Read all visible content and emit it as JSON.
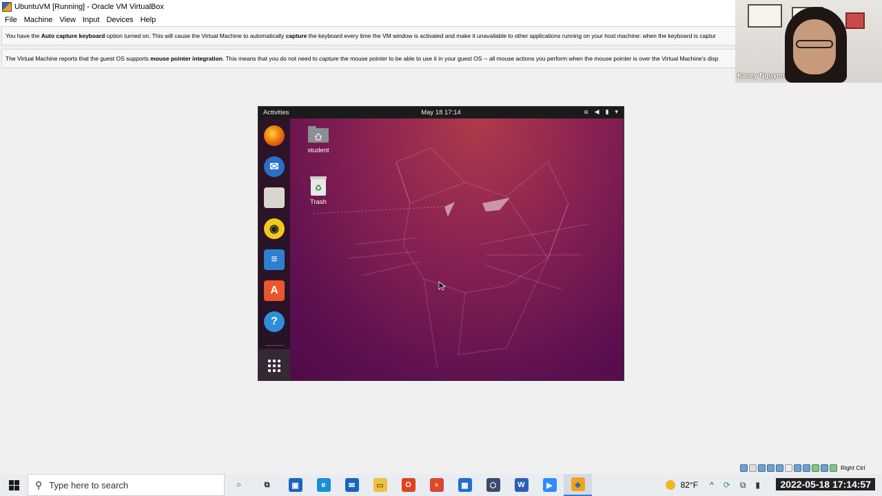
{
  "window": {
    "title": "UbuntuVM [Running] - Oracle VM VirtualBox"
  },
  "menu": [
    "File",
    "Machine",
    "View",
    "Input",
    "Devices",
    "Help"
  ],
  "banners": {
    "keyboard": {
      "p1": "You have the ",
      "b1": "Auto capture keyboard",
      "p2": " option turned on. This will cause the Virtual Machine to automatically ",
      "b2": "capture",
      "p3": " the keyboard every time the VM window is activated and make it unavailable to other applications running on your host machine: when the keyboard is captur"
    },
    "mouse": {
      "p1": "The Virtual Machine reports that the guest OS supports ",
      "b1": "mouse pointer integration",
      "p2": ". This means that you do not need to ",
      "i1": "capture",
      "p3": " the mouse pointer to be able to use it in your guest OS -- all mouse actions you perform when the mouse pointer is over the Virtual Machine's disp"
    }
  },
  "guest": {
    "activities": "Activities",
    "clock": "May 18  17:14",
    "desktop_icons": [
      {
        "label": "student",
        "icon": "home-folder-icon"
      },
      {
        "label": "Trash",
        "icon": "trash-icon"
      }
    ],
    "dock": [
      {
        "name": "firefox-icon",
        "color": "#e66000",
        "glyph": ""
      },
      {
        "name": "thunderbird-icon",
        "color": "#2a6fc9",
        "glyph": "✉"
      },
      {
        "name": "files-icon",
        "color": "#d9d6cf",
        "glyph": ""
      },
      {
        "name": "rhythmbox-icon",
        "color": "#f2c81c",
        "glyph": "◉"
      },
      {
        "name": "writer-icon",
        "color": "#2f7fd0",
        "glyph": "≡"
      },
      {
        "name": "software-center-icon",
        "color": "#e9562b",
        "glyph": "A"
      },
      {
        "name": "help-icon",
        "color": "#2f8ed8",
        "glyph": "?"
      }
    ]
  },
  "webcam": {
    "name": "Kasey Nguyen"
  },
  "vbox_status": {
    "host_key": "Right Ctrl"
  },
  "taskbar": {
    "search_placeholder": "Type here to search",
    "apps": [
      {
        "name": "cortana-icon",
        "glyph": "○",
        "color": "transparent",
        "fg": "#222"
      },
      {
        "name": "task-view-icon",
        "glyph": "⧉",
        "color": "transparent",
        "fg": "#222"
      },
      {
        "name": "store-icon",
        "glyph": "▣",
        "color": "#1e63c4",
        "fg": "#fff"
      },
      {
        "name": "edge-icon",
        "glyph": "e",
        "color": "#1a8fd6",
        "fg": "#fff"
      },
      {
        "name": "mail-icon",
        "glyph": "✉",
        "color": "#1666c0",
        "fg": "#fff"
      },
      {
        "name": "file-explorer-icon",
        "glyph": "▭",
        "color": "#f0c040",
        "fg": "#7a5a10"
      },
      {
        "name": "office-icon",
        "glyph": "O",
        "color": "#e2421b",
        "fg": "#fff"
      },
      {
        "name": "chrome-icon",
        "glyph": "●",
        "color": "#db4437",
        "fg": "#f4c20d"
      },
      {
        "name": "calendar-icon",
        "glyph": "▦",
        "color": "#1e6fd0",
        "fg": "#fff"
      },
      {
        "name": "virtualbox-icon",
        "glyph": "⬡",
        "color": "#3a4a6a",
        "fg": "#fff"
      },
      {
        "name": "word-icon",
        "glyph": "W",
        "color": "#2b5fb4",
        "fg": "#fff"
      },
      {
        "name": "zoom-icon",
        "glyph": "▶",
        "color": "#2d8cff",
        "fg": "#fff"
      },
      {
        "name": "ubuntuvm-taskbar-icon",
        "glyph": "◆",
        "color": "#f2a31a",
        "fg": "#2d6bb5"
      }
    ],
    "temperature": "82°F",
    "timestamp": "2022-05-18  17:14:57"
  }
}
